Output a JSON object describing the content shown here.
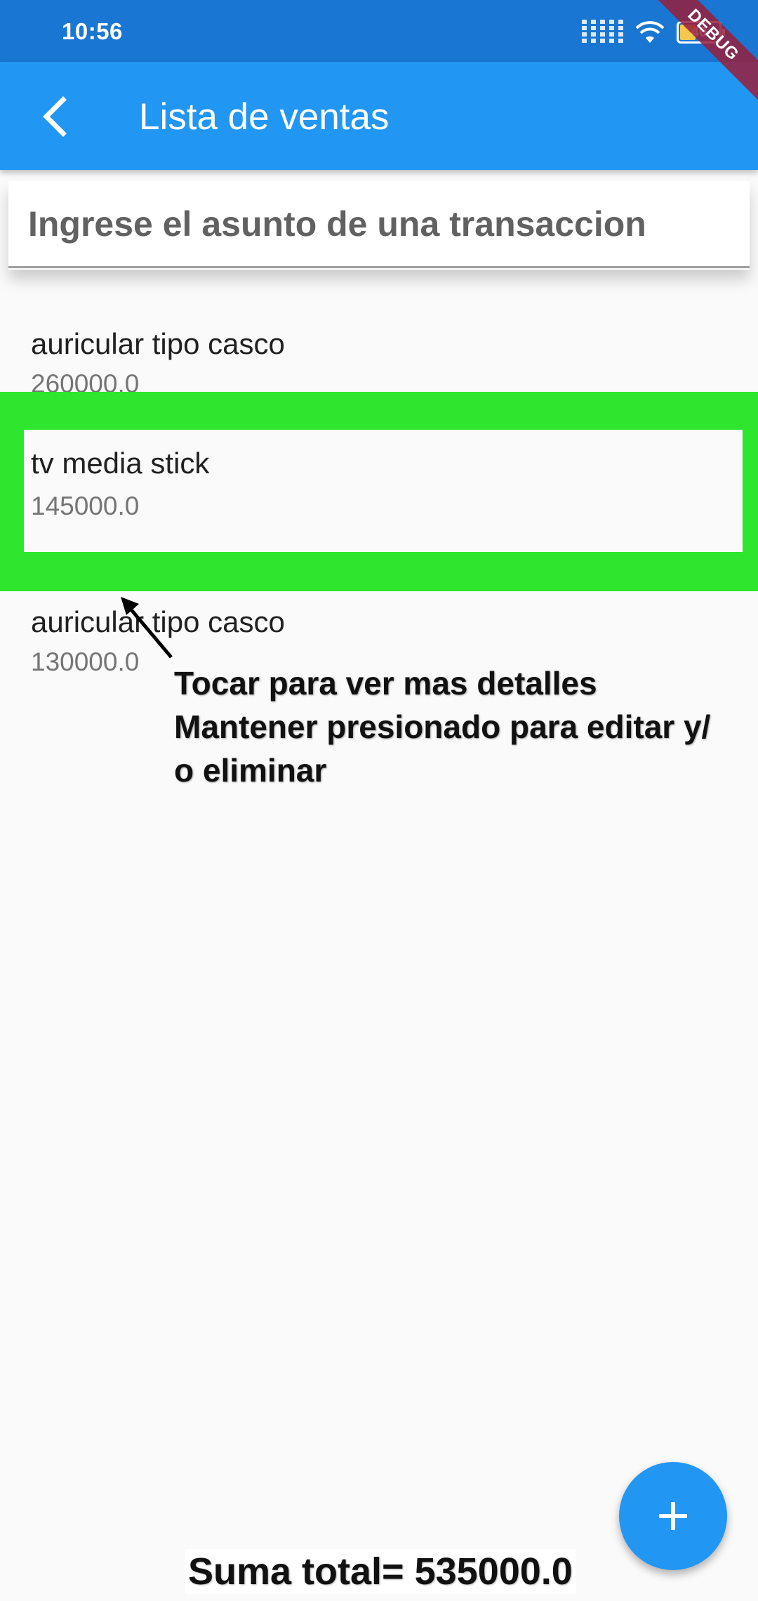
{
  "status_bar": {
    "time": "10:56",
    "battery_level": "40",
    "battery_fraction": 0.4,
    "icons": [
      "signal-icon",
      "wifi-icon",
      "battery-icon"
    ]
  },
  "debug_banner": "DEBUG",
  "app_bar": {
    "title": "Lista de ventas",
    "back_icon": "chevron-left-icon",
    "color": "#2196f3",
    "status_color": "#1976d2"
  },
  "search": {
    "placeholder": "Ingrese el asunto de una transaccion",
    "value": ""
  },
  "items": [
    {
      "title": "auricular tipo casco",
      "subtitle": "260000.0"
    },
    {
      "title": "tv media stick",
      "subtitle": "145000.0"
    },
    {
      "title": "auricular tipo casco",
      "subtitle": "130000.0"
    }
  ],
  "highlight_color": "#2de62d",
  "hint": {
    "line1": "Tocar para ver mas detalles",
    "line2": "Mantener presionado para editar y/",
    "line3": "o eliminar"
  },
  "fab": {
    "icon": "plus-icon"
  },
  "total": "Suma total= 535000.0"
}
